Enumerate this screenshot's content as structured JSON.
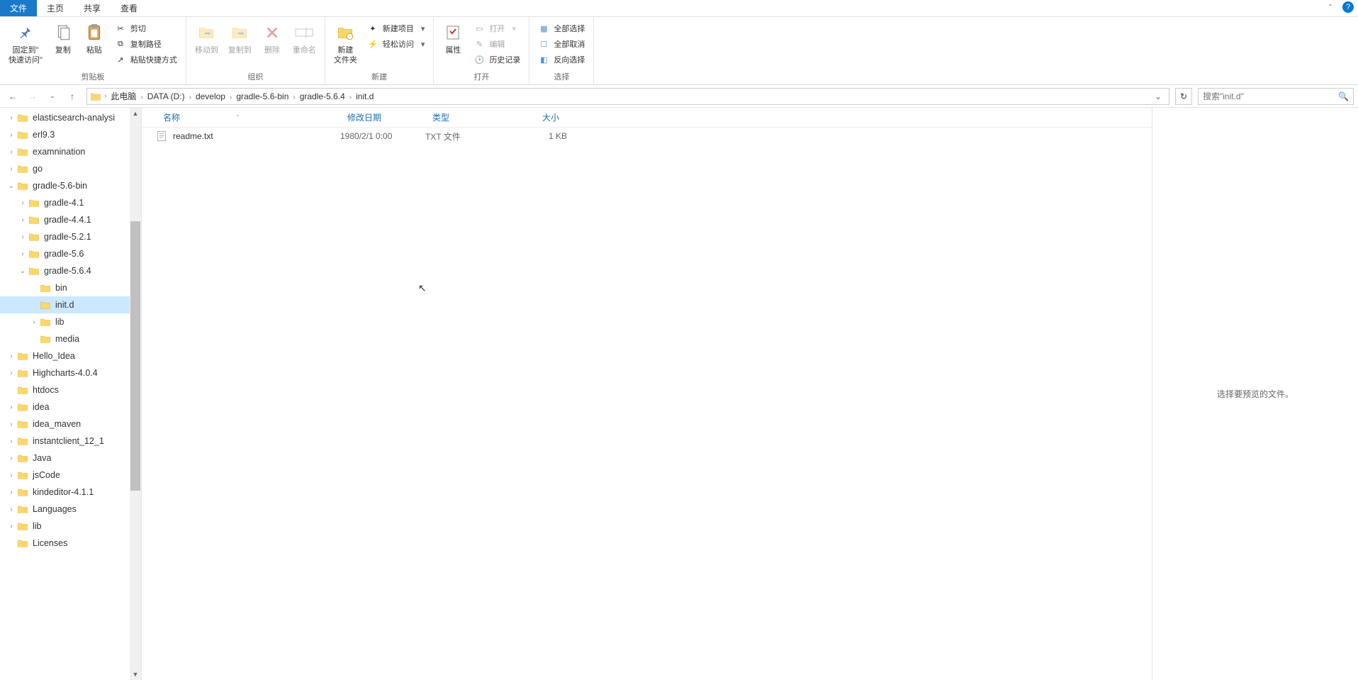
{
  "tabs": {
    "file": "文件",
    "home": "主页",
    "share": "共享",
    "view": "查看"
  },
  "ribbon": {
    "pin": "固定到\"\n快速访问\"",
    "copy": "复制",
    "paste": "粘贴",
    "cut": "剪切",
    "copy_path": "复制路径",
    "paste_shortcut": "粘贴快捷方式",
    "clipboard_group": "剪贴板",
    "move_to": "移动到",
    "copy_to": "复制到",
    "delete": "删除",
    "rename": "重命名",
    "organize_group": "组织",
    "new_folder": "新建\n文件夹",
    "new_item": "新建项目",
    "easy_access": "轻松访问",
    "new_group": "新建",
    "properties": "属性",
    "open": "打开",
    "edit": "编辑",
    "history": "历史记录",
    "open_group": "打开",
    "select_all": "全部选择",
    "select_none": "全部取消",
    "invert_selection": "反向选择",
    "select_group": "选择"
  },
  "breadcrumb": [
    "此电脑",
    "DATA (D:)",
    "develop",
    "gradle-5.6-bin",
    "gradle-5.6.4",
    "init.d"
  ],
  "search_placeholder": "搜索\"init.d\"",
  "columns": {
    "name": "名称",
    "date": "修改日期",
    "type": "类型",
    "size": "大小"
  },
  "files": [
    {
      "name": "readme.txt",
      "date": "1980/2/1 0:00",
      "type": "TXT 文件",
      "size": "1 KB"
    }
  ],
  "preview_hint": "选择要预览的文件。",
  "tree": [
    {
      "indent": 1,
      "toggle": "▶",
      "label": "elasticsearch-analysi"
    },
    {
      "indent": 1,
      "toggle": "▶",
      "label": "erl9.3"
    },
    {
      "indent": 1,
      "toggle": "▶",
      "label": "examnination"
    },
    {
      "indent": 1,
      "toggle": "▶",
      "label": "go"
    },
    {
      "indent": 1,
      "toggle": "▾",
      "label": "gradle-5.6-bin"
    },
    {
      "indent": 2,
      "toggle": "▶",
      "label": "gradle-4.1"
    },
    {
      "indent": 2,
      "toggle": "▶",
      "label": "gradle-4.4.1"
    },
    {
      "indent": 2,
      "toggle": "▶",
      "label": "gradle-5.2.1"
    },
    {
      "indent": 2,
      "toggle": "▶",
      "label": "gradle-5.6"
    },
    {
      "indent": 2,
      "toggle": "▾",
      "label": "gradle-5.6.4"
    },
    {
      "indent": 3,
      "toggle": "",
      "label": "bin"
    },
    {
      "indent": 3,
      "toggle": "",
      "label": "init.d",
      "selected": true
    },
    {
      "indent": 3,
      "toggle": "▶",
      "label": "lib"
    },
    {
      "indent": 3,
      "toggle": "",
      "label": "media"
    },
    {
      "indent": 1,
      "toggle": "▶",
      "label": "Hello_Idea"
    },
    {
      "indent": 1,
      "toggle": "▶",
      "label": "Highcharts-4.0.4"
    },
    {
      "indent": 1,
      "toggle": "",
      "label": "htdocs"
    },
    {
      "indent": 1,
      "toggle": "▶",
      "label": "idea"
    },
    {
      "indent": 1,
      "toggle": "▶",
      "label": "idea_maven"
    },
    {
      "indent": 1,
      "toggle": "▶",
      "label": "instantclient_12_1"
    },
    {
      "indent": 1,
      "toggle": "▶",
      "label": "Java"
    },
    {
      "indent": 1,
      "toggle": "▶",
      "label": "jsCode"
    },
    {
      "indent": 1,
      "toggle": "▶",
      "label": "kindeditor-4.1.1"
    },
    {
      "indent": 1,
      "toggle": "▶",
      "label": "Languages"
    },
    {
      "indent": 1,
      "toggle": "▶",
      "label": "lib"
    },
    {
      "indent": 1,
      "toggle": "",
      "label": "Licenses"
    }
  ]
}
